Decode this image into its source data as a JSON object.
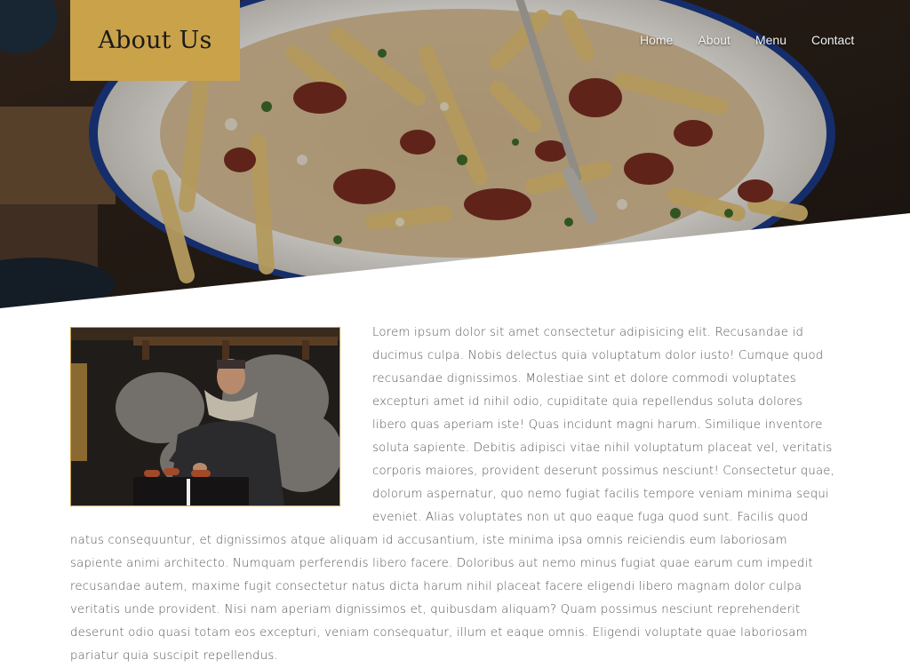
{
  "header": {
    "title": "About Us",
    "accent_color": "#c9a24a"
  },
  "nav": {
    "items": [
      {
        "label": "Home"
      },
      {
        "label": "About"
      },
      {
        "label": "Menu"
      },
      {
        "label": "Contact"
      }
    ]
  },
  "hero": {
    "image": "poutine-fries-plate-photo"
  },
  "content": {
    "image": "chef-grilling-sausages-photo",
    "paragraph": "Lorem ipsum dolor sit amet consectetur adipisicing elit. Recusandae id ducimus culpa. Nobis delectus quia voluptatum dolor iusto! Cumque quod recusandae dignissimos. Molestiae sint et dolore commodi voluptates excepturi amet id nihil odio, cupiditate quia repellendus soluta dolores libero quas aperiam iste! Quas incidunt magni harum. Similique inventore soluta sapiente. Debitis adipisci vitae nihil voluptatum placeat vel, veritatis corporis maiores, provident deserunt possimus nesciunt! Consectetur quae, dolorum aspernatur, quo nemo fugiat facilis tempore veniam minima sequi eveniet. Alias voluptates non ut quo eaque fuga quod sunt. Facilis quod natus consequuntur, et dignissimos atque aliquam id accusantium, iste minima ipsa omnis reiciendis eum laboriosam sapiente animi architecto. Numquam perferendis libero facere. Doloribus aut nemo minus fugiat quae earum cum impedit recusandae autem, maxime fugit consectetur natus dicta harum nihil placeat facere eligendi libero magnam dolor culpa veritatis unde provident. Nisi nam aperiam dignissimos et, quibusdam aliquam? Quam possimus nesciunt reprehenderit deserunt odio quasi totam eos excepturi, veniam consequatur, illum et eaque omnis. Eligendi voluptate quae laboriosam pariatur quia suscipit repellendus."
  }
}
